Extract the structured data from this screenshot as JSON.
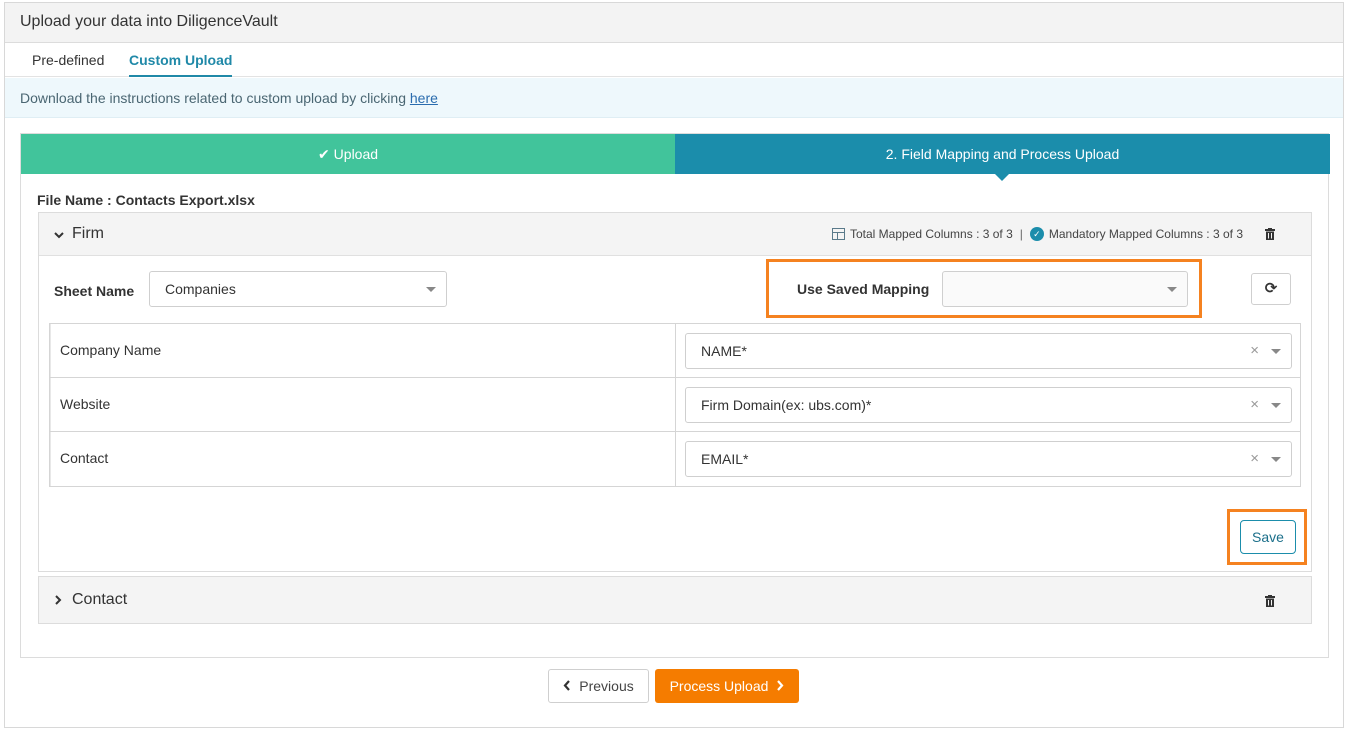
{
  "title": "Upload your data into DiligenceVault",
  "tabs": {
    "predefined": "Pre-defined",
    "custom": "Custom Upload"
  },
  "info": {
    "text": "Download the instructions related to custom upload by clicking ",
    "link": "here"
  },
  "steps": {
    "step1": "Upload",
    "step2": "2. Field Mapping and Process Upload"
  },
  "file": {
    "label": "File Name : ",
    "value": "Contacts Export.xlsx"
  },
  "firm": {
    "title": "Firm",
    "total_mapped": "Total Mapped Columns : 3 of 3",
    "separator": "|",
    "mandatory_mapped": "Mandatory Mapped Columns : 3 of 3",
    "sheet_label": "Sheet Name",
    "sheet_value": "Companies",
    "saved_mapping_label": "Use Saved Mapping",
    "saved_mapping_value": "",
    "rows": [
      {
        "field": "Company Name",
        "mapped": "NAME*"
      },
      {
        "field": "Website",
        "mapped": "Firm Domain(ex: ubs.com)*"
      },
      {
        "field": "Contact",
        "mapped": "EMAIL*"
      }
    ],
    "save_label": "Save"
  },
  "contact": {
    "title": "Contact"
  },
  "footer": {
    "previous": "Previous",
    "process": "Process Upload"
  },
  "icons": {
    "check": "check-icon",
    "chevron_down": "chevron-down-icon",
    "chevron_right": "chevron-right-icon",
    "table": "table-icon",
    "check_circle": "check-circle-icon",
    "trash": "trash-icon",
    "refresh": "refresh-icon",
    "clear": "clear-icon",
    "caret": "caret-down-icon"
  },
  "colors": {
    "step_done": "#41c49b",
    "step_active": "#1b8dab",
    "highlight": "#f58220",
    "primary_button": "#f57c00",
    "tab_active": "#2089a8",
    "info_bg": "#eef8fc"
  }
}
